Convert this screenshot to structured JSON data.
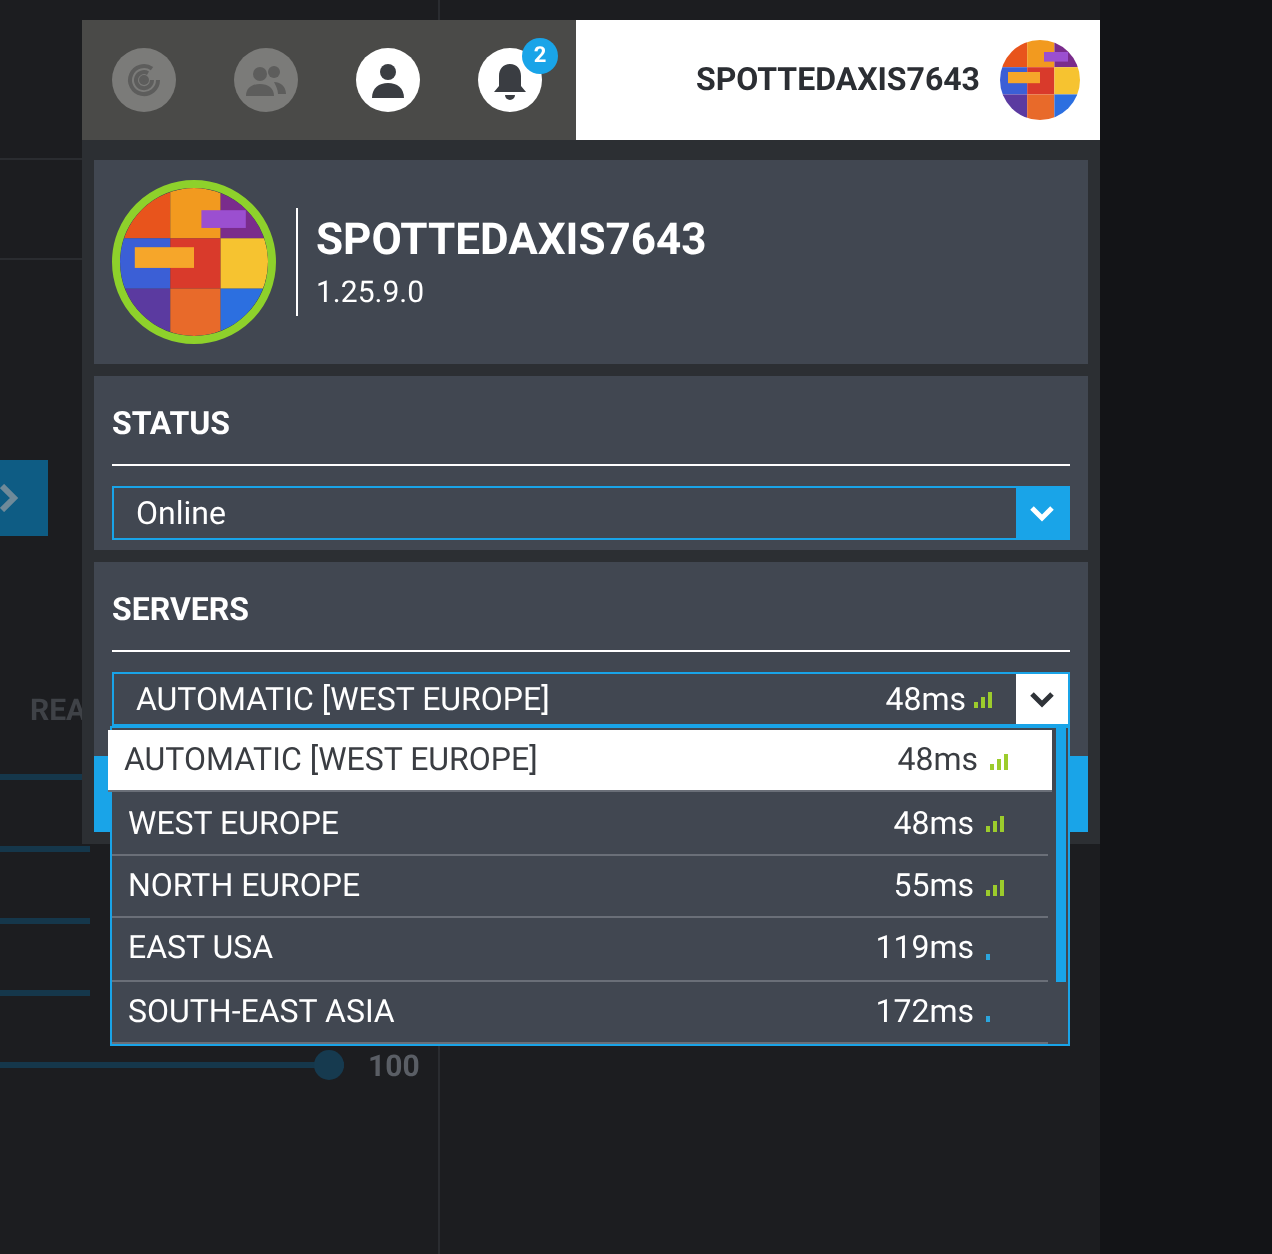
{
  "background": {
    "section_label": "REA",
    "slider": {
      "level": 1,
      "value": "100"
    }
  },
  "top_bar": {
    "icons": [
      {
        "kind": "radar",
        "highlighted": false
      },
      {
        "kind": "friends",
        "highlighted": false
      },
      {
        "kind": "user",
        "highlighted": true
      },
      {
        "kind": "bell",
        "highlighted": true,
        "badge": "2"
      }
    ],
    "user_name": "SPOTTEDAXIS7643"
  },
  "profile": {
    "name": "SPOTTEDAXIS7643",
    "version": "1.25.9.0"
  },
  "status": {
    "title": "STATUS",
    "value": "Online",
    "open": false
  },
  "servers": {
    "title": "SERVERS",
    "value": "AUTOMATIC [WEST EUROPE]",
    "ping": "48ms",
    "kind": "strong",
    "open": true,
    "options": [
      {
        "name": "AUTOMATIC [WEST EUROPE]",
        "ping": "48ms",
        "kind": "strong",
        "selected": true
      },
      {
        "name": "WEST EUROPE",
        "ping": "48ms",
        "kind": "strong",
        "selected": false
      },
      {
        "name": "NORTH EUROPE",
        "ping": "55ms",
        "kind": "strong",
        "selected": false
      },
      {
        "name": "EAST USA",
        "ping": "119ms",
        "kind": "weak",
        "selected": false
      },
      {
        "name": "SOUTH-EAST ASIA",
        "ping": "172ms",
        "kind": "weak",
        "selected": false
      }
    ]
  }
}
